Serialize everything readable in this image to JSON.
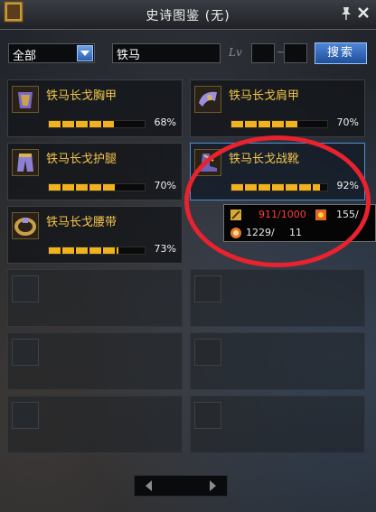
{
  "window": {
    "title": "史诗图鉴 (无)"
  },
  "filters": {
    "category": "全部",
    "search_value": "铁马",
    "level_label": "Lv",
    "level_separator": "~",
    "search_button": "搜索"
  },
  "items": [
    {
      "name": "铁马长戈胸甲",
      "progress_text": "68%",
      "progress": 0.68
    },
    {
      "name": "铁马长戈肩甲",
      "progress_text": "70%",
      "progress": 0.7
    },
    {
      "name": "铁马长戈护腿",
      "progress_text": "70%",
      "progress": 0.7
    },
    {
      "name": "铁马长戈战靴",
      "progress_text": "92%",
      "progress": 0.92
    },
    {
      "name": "铁马长戈腰带",
      "progress_text": "73%",
      "progress": 0.73
    }
  ],
  "tooltip": {
    "stat1": "911/1000",
    "stat2": "155/",
    "stat3": "1229/",
    "stat4": "11"
  },
  "colors": {
    "item_name": "#f3c44a",
    "progress_fill": "#f2b21d",
    "selected_border": "#4d8fd6",
    "highlight_ring": "#e8222e",
    "tooltip_stat_red": "#ff3b3b"
  }
}
